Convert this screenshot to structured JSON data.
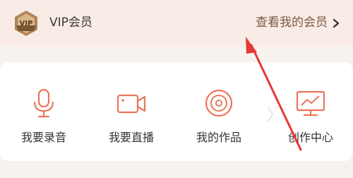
{
  "vip": {
    "badge_text": "VIP",
    "label": "VIP会员",
    "link_label": "查看我的会员"
  },
  "tools": [
    {
      "label": "我要录音",
      "icon": "microphone-icon"
    },
    {
      "label": "我要直播",
      "icon": "video-camera-icon"
    },
    {
      "label": "我的作品",
      "icon": "disc-icon"
    },
    {
      "label": "创作中心",
      "icon": "monitor-chart-icon"
    }
  ],
  "colors": {
    "accent": "#e9765a",
    "vip_bar_bg": "#f9ece6",
    "link_text": "#7b5a45",
    "badge_gold": "#c79a6a",
    "annotation_arrow": "#e53935"
  }
}
